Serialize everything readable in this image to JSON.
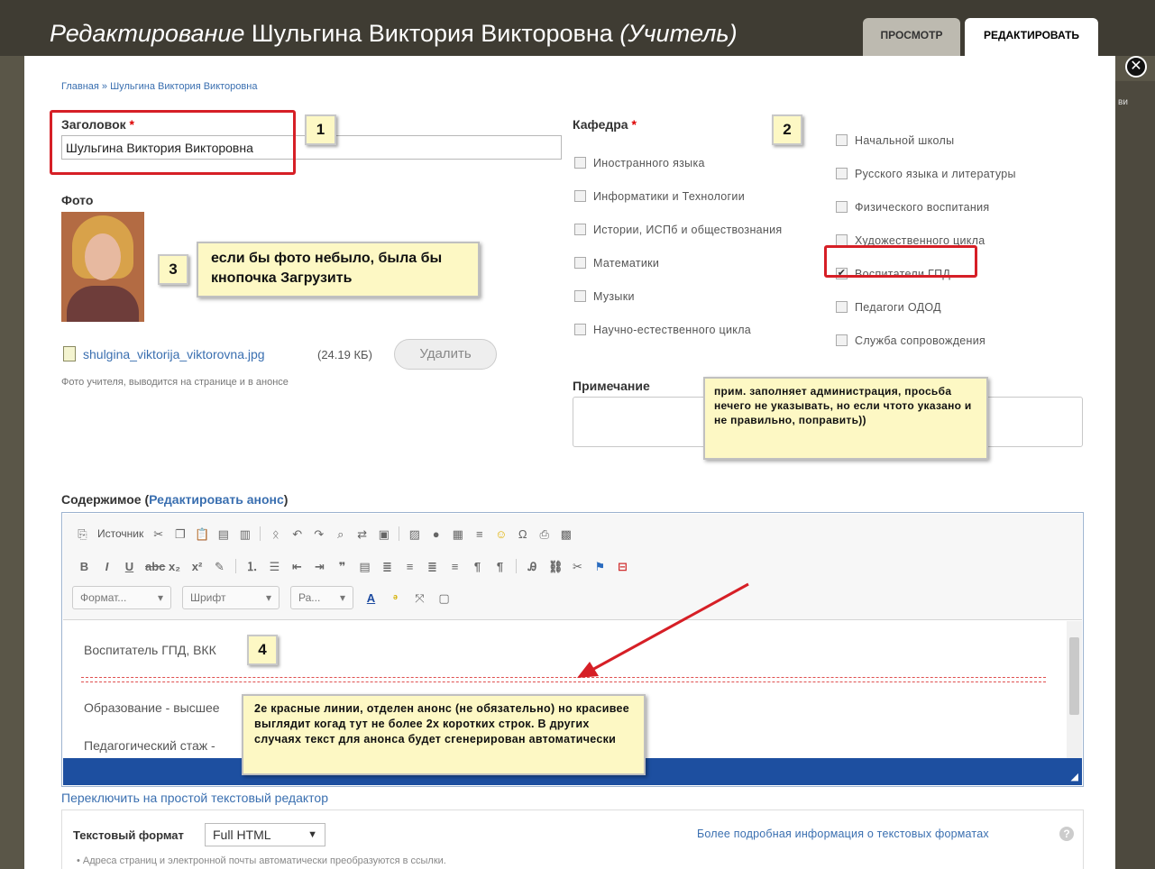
{
  "dialog": {
    "title_italic": "Редактирование",
    "title_name": "Шульгина Виктория Викторовна",
    "title_role": "(Учитель)",
    "tabs": [
      "ПРОСМОТР",
      "РЕДАКТИРОВАТЬ"
    ],
    "active_tab": "РЕДАКТИРОВАТЬ",
    "right_edge_text": "ви"
  },
  "breadcrumb": "Главная » Шульгина Виктория Викторовна",
  "title_field": {
    "label": "Заголовок",
    "required_mark": "*",
    "value": "Шульгина Виктория Викторовна"
  },
  "photo": {
    "label": "Фото",
    "file_name": "shulgina_viktorija_viktorovna.jpg",
    "file_size": "(24.19 КБ)",
    "delete_label": "Удалить",
    "hint": "Фото учителя, выводится на странице и в анонсе"
  },
  "department": {
    "label": "Кафедра",
    "required_mark": "*",
    "col1": [
      {
        "label": "Иностранного языка",
        "checked": false
      },
      {
        "label": "Информатики и Технологии",
        "checked": false
      },
      {
        "label": "Истории, ИСПб и обществознания",
        "checked": false
      },
      {
        "label": "Математики",
        "checked": false
      },
      {
        "label": "Музыки",
        "checked": false
      },
      {
        "label": "Научно-естественного цикла",
        "checked": false
      }
    ],
    "col2": [
      {
        "label": "Начальной школы",
        "checked": false
      },
      {
        "label": "Русского языка и литературы",
        "checked": false
      },
      {
        "label": "Физического воспитания",
        "checked": false
      },
      {
        "label": "Художественного цикла",
        "checked": false
      },
      {
        "label": "Воспитатели ГПД",
        "checked": true
      },
      {
        "label": "Педагоги ОДОД",
        "checked": false
      },
      {
        "label": "Служба сопровождения",
        "checked": false
      }
    ]
  },
  "note": {
    "label": "Примечание",
    "value": ""
  },
  "content": {
    "label": "Содержимое",
    "edit_summary_link": "Редактировать анонс",
    "toolbar": {
      "source_label": "Источник",
      "format_label": "Формат...",
      "font_label": "Шрифт",
      "size_label": "Ра..."
    },
    "lines": [
      "Воспитатель ГПД, ВКК",
      "Образование - высшее",
      "Педагогический стаж -"
    ],
    "switch_link": "Переключить на простой текстовый редактор"
  },
  "text_format": {
    "label": "Текстовый формат",
    "value": "Full HTML",
    "more_info_link": "Более подробная информация о текстовых форматах",
    "tip": "Адреса страниц и электронной почты автоматически преобразуются в ссылки."
  },
  "callouts": {
    "n1": "1",
    "n2": "2",
    "n3": "3",
    "n4": "4",
    "photo_note": "если бы фото небыло, была бы кнопочка Загрузить",
    "note_note": "прим. заполняет администрация, просьба нечего не указывать, но если чтото указано и не правильно, поправить))",
    "summary_note": "2е красные линии, отделен анонс (не обязательно) но красивее выглядит когад тут не более 2х коротких строк. В других случаях текст для анонса будет сгенерирован автоматически"
  },
  "colors": {
    "header_bg": "#3f3c33",
    "link": "#3a6fb0",
    "callout_bg": "#fdf8c4",
    "highlight_red": "#d61f26",
    "editor_status": "#1d4fa0"
  }
}
